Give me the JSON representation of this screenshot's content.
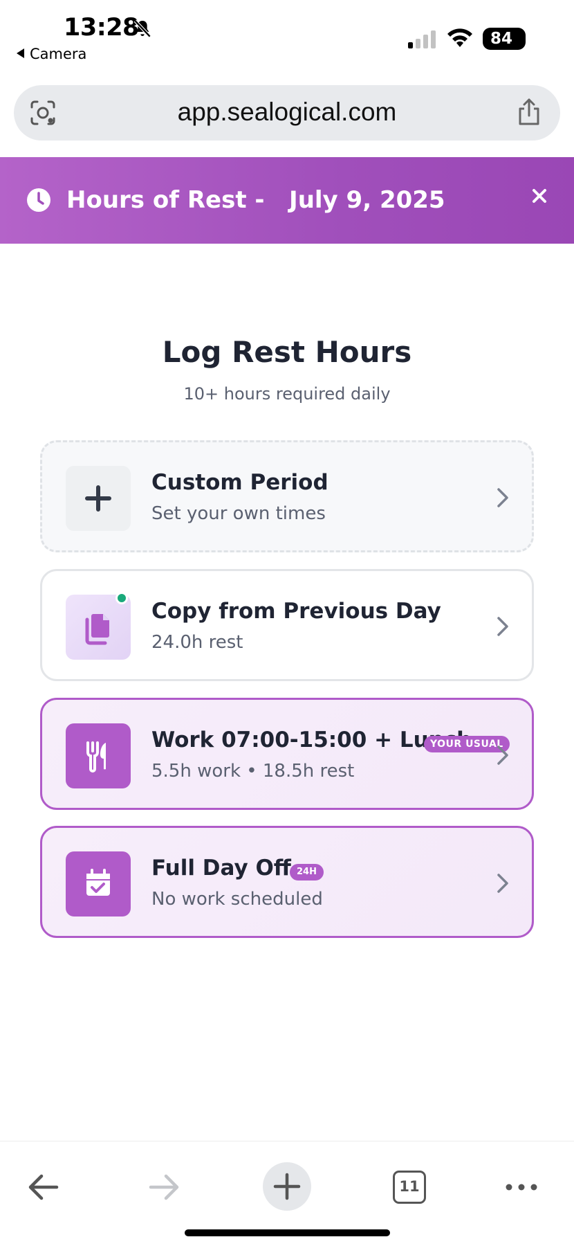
{
  "status_bar": {
    "time": "13:28",
    "back_app": "Camera",
    "battery": "84"
  },
  "browser": {
    "url": "app.sealogical.com",
    "tab_count": "11"
  },
  "banner": {
    "title": "Hours of Rest -   July 9, 2025"
  },
  "main": {
    "heading": "Log Rest Hours",
    "subheading": "10+ hours required daily",
    "options": [
      {
        "title": "Custom Period",
        "subtitle": "Set your own times"
      },
      {
        "title": "Copy from Previous Day",
        "subtitle": "24.0h rest"
      },
      {
        "title": "Work 07:00-15:00 + Lunch",
        "subtitle": "5.5h work • 18.5h rest",
        "badge": "YOUR USUAL"
      },
      {
        "title": "Full Day Off",
        "subtitle": "No work scheduled",
        "badge": "24H"
      }
    ]
  },
  "colors": {
    "accent": "#b05bc9",
    "banner": "#a04fbb",
    "status_dot": "#19a97b"
  },
  "icons": [
    "bell-slash-icon",
    "camera-back-icon",
    "cellular-signal-icon",
    "wifi-icon",
    "battery-icon",
    "lens-icon",
    "share-icon",
    "clock-icon",
    "close-icon",
    "plus-icon",
    "copy-icon",
    "utensils-icon",
    "calendar-check-icon",
    "chevron-right-icon",
    "arrow-left-icon",
    "arrow-right-icon",
    "new-tab-plus-icon",
    "tabs-icon",
    "more-icon"
  ]
}
